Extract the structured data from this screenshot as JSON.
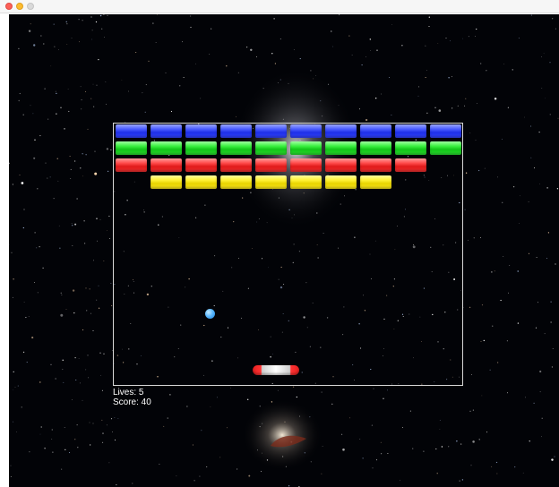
{
  "window": {
    "controls": [
      "close-button",
      "minimize-button",
      "maximize-button"
    ]
  },
  "hud": {
    "lives_text": "Lives: 5",
    "score_text": "Score: 40"
  },
  "bricks": {
    "rows": [
      {
        "color": "blue",
        "count": 10,
        "offset": 0
      },
      {
        "color": "green",
        "count": 10,
        "offset": 0
      },
      {
        "color": "red",
        "count": 9,
        "offset": 0
      },
      {
        "color": "yellow",
        "count": 7,
        "offset": 1
      }
    ]
  },
  "colors": {
    "background": "#020307",
    "field_border": "#d8d8d8",
    "hud_text": "#ffffff"
  }
}
